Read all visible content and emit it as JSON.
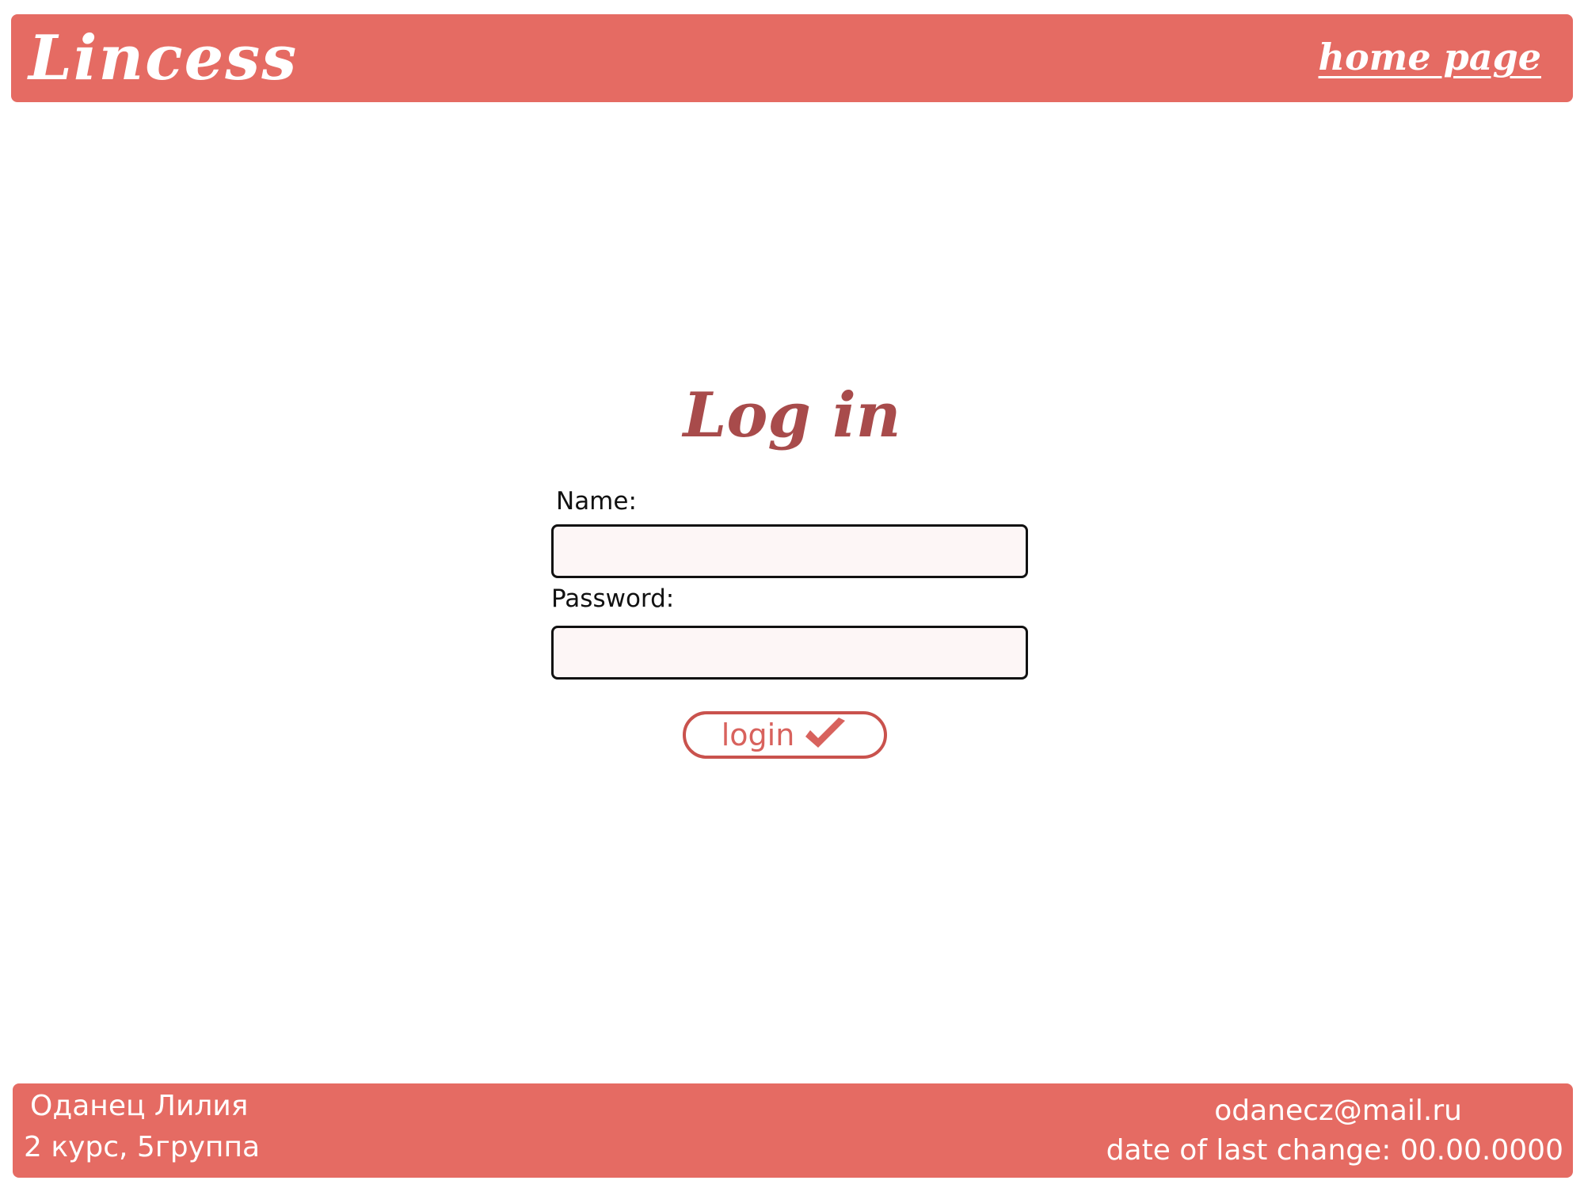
{
  "header": {
    "logo": "Lincess",
    "home_link": "home page"
  },
  "login": {
    "title": "Log in",
    "name_label": "Name:",
    "name_value": "",
    "password_label": "Password:",
    "password_value": "",
    "button_label": "login",
    "button_icon": "checkmark-icon"
  },
  "footer": {
    "author": "Оданец Лилия",
    "group": "2 курс, 5группа",
    "email": "odanecz@mail.ru",
    "last_change": "date of last change: 00.00.0000"
  },
  "colors": {
    "accent": "#e56b63",
    "title": "#a84b4b",
    "button_border": "#c9524d",
    "field_bg": "#fdf6f6"
  }
}
